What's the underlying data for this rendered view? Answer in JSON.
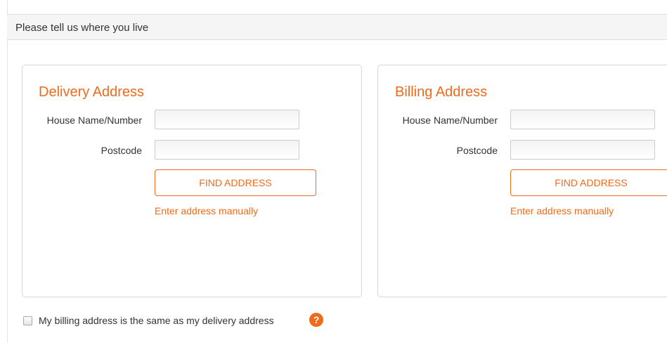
{
  "header": {
    "title": "Please tell us where you live"
  },
  "delivery": {
    "title": "Delivery Address",
    "house_label": "House Name/Number",
    "house_value": "",
    "postcode_label": "Postcode",
    "postcode_value": "",
    "find_button": "FIND ADDRESS",
    "manual_link": "Enter address manually"
  },
  "billing": {
    "title": "Billing Address",
    "house_label": "House Name/Number",
    "house_value": "",
    "postcode_label": "Postcode",
    "postcode_value": "",
    "find_button": "FIND ADDRESS",
    "manual_link": "Enter address manually"
  },
  "same_address": {
    "label": "My billing address is the same as my delivery address",
    "checked": false,
    "help_icon": "question-circle-icon",
    "help_glyph": "?"
  },
  "colors": {
    "accent": "#ee6a1c",
    "text": "#333333",
    "header_bg": "#f5f5f5",
    "border": "#d6d6d6"
  }
}
